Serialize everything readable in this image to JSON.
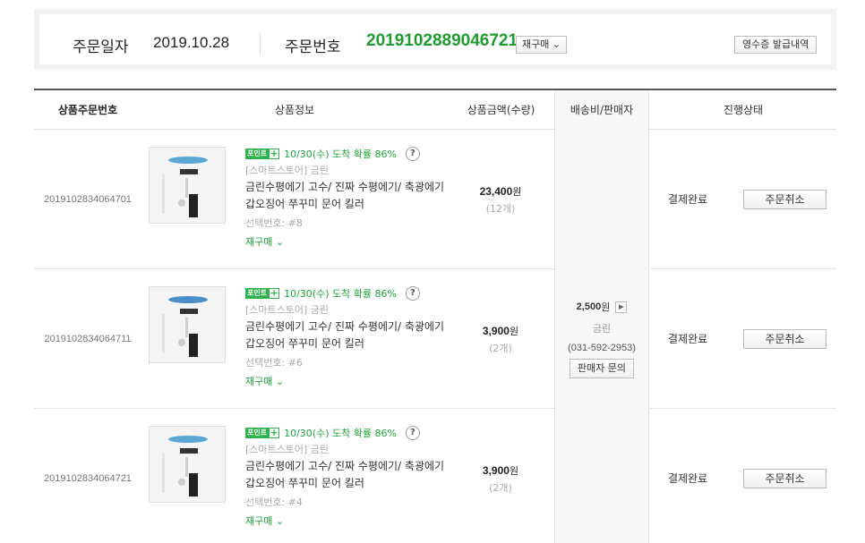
{
  "order": {
    "date_label": "주문일자",
    "date": "2019.10.28",
    "number_label": "주문번호",
    "number": "2019102889046721",
    "reorder_label": "재구매",
    "receipt_label": "영수증 발급내역"
  },
  "table": {
    "headers": [
      "상품주문번호",
      "상품정보",
      "상품금액(수량)",
      "배송비/판매자",
      "진행상태"
    ]
  },
  "products": [
    {
      "id": "2019102834064701",
      "point_badge": "포인트",
      "delivery_note": "10/30(수) 도착 확률 86%",
      "store": "[스마트스토어] 금린",
      "name": "금린수평에기 고수/ 진짜 수평에기/ 축광에기 갑오징어 쭈꾸미 문어 킬러",
      "option": "선택번호: #8",
      "reorder": "재구매",
      "price": "23,400",
      "price_unit": "원",
      "qty": "(12개)",
      "status": "결제완료",
      "cancel": "주문취소"
    },
    {
      "id": "2019102834064711",
      "point_badge": "포인트",
      "delivery_note": "10/30(수) 도착 확률 86%",
      "store": "[스마트스토어] 금린",
      "name": "금린수평에기 고수/ 진짜 수평에기/ 축광에기 갑오징어 쭈꾸미 문어 킬러",
      "option": "선택번호: #6",
      "reorder": "재구매",
      "price": "3,900",
      "price_unit": "원",
      "qty": "(2개)",
      "status": "결제완료",
      "cancel": "주문취소"
    },
    {
      "id": "2019102834064721",
      "point_badge": "포인트",
      "delivery_note": "10/30(수) 도착 확률 86%",
      "store": "[스마트스토어] 금린",
      "name": "금린수평에기 고수/ 진짜 수평에기/ 축광에기 갑오징어 쭈꾸미 문어 킬러",
      "option": "선택번호: #4",
      "reorder": "재구매",
      "price": "3,900",
      "price_unit": "원",
      "qty": "(2개)",
      "status": "결제완료",
      "cancel": "주문취소"
    }
  ],
  "shipping": {
    "fee": "2,500",
    "fee_unit": "원",
    "seller": "금린",
    "phone": "(031-592-2953)",
    "inquiry_label": "판매자 문의"
  },
  "colors": {
    "accent_green": "#1f9c2e",
    "badge_green": "#2eb34a"
  },
  "icons": {
    "plus": "plus-icon",
    "help": "question-icon",
    "chevron": "chevron-down-icon",
    "arrow": "arrow-right-icon"
  }
}
